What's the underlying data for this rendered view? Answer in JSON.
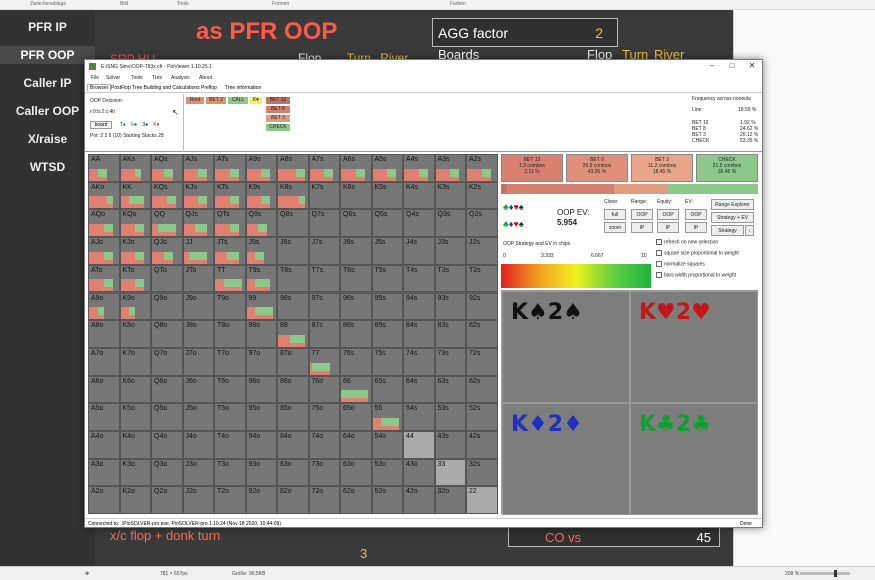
{
  "browser_top": {
    "items": [
      "Zwischenablage",
      "Bild",
      "Tools",
      "Formen",
      "Farben"
    ]
  },
  "left_nav": [
    "PFR IP",
    "PFR OOP",
    "Caller IP",
    "Caller OOP",
    "X/raise",
    "WTSD"
  ],
  "slide": {
    "title": "as PFR OOP",
    "srp": "SRP HU",
    "flop_labels": [
      "Flop",
      "Turn",
      "River"
    ],
    "agg_label": "AGG factor",
    "agg_value": "2",
    "boards_label": "Boards",
    "boards_cols": [
      "Flop",
      "Turn",
      "River"
    ],
    "bottom_text": "x/c flop + donk turn",
    "bottom_num": "3",
    "covs_label": "CO vs",
    "covs_value": "45"
  },
  "window": {
    "title": "E:\\SNG Sims\\OOP-T83x.cfr - PioViewer 1.10.25.1",
    "menu": [
      "File",
      "Solver",
      "Tools",
      "Tree",
      "Analysis",
      "About"
    ],
    "tabs": [
      "Browser",
      "PostFlop Tree Building and Calculations",
      "Preflop",
      "Tree information"
    ],
    "decision_label": "OOP Decision:",
    "line": "r:0:b:2:c:4h",
    "board_btn": "board",
    "board_cards": [
      "T♦",
      "8♣",
      "3♠",
      "K♥"
    ],
    "pot": "Pot: 2 2 6 (10) Starting Stacks 28",
    "path_tags": [
      "Root",
      "BET 2",
      "CALL",
      "K♥"
    ],
    "action_tags": [
      "BET 12",
      "BET 8",
      "BET 3",
      "CHECK"
    ],
    "freq_title": "Frequency across nonouts",
    "freq_line": "Line:",
    "freq_line_val": "18.59 %",
    "freq": [
      {
        "name": "BET 12",
        "val": "1.92 %"
      },
      {
        "name": "BET 8",
        "val": "24.62 %"
      },
      {
        "name": "BET 3",
        "val": "20.12 %"
      },
      {
        "name": "CHECK",
        "val": "53.35 %"
      }
    ],
    "strategy": [
      {
        "name": "BET 12",
        "combos": "1.3 combos",
        "pct": "2.11 %",
        "color": "#d98070"
      },
      {
        "name": "BET 8",
        "combos": "26.9 combos",
        "pct": "43.95 %",
        "color": "#e0907a"
      },
      {
        "name": "BET 3",
        "combos": "11.2 combos",
        "pct": "18.45 %",
        "color": "#e8a58a"
      },
      {
        "name": "CHECK",
        "combos": "21.5 combos",
        "pct": "35.45 %",
        "color": "#8cc88a"
      }
    ],
    "oop_ev_label": "OOP EV:",
    "oop_ev": "5.954",
    "ctl_labels": [
      "Clone:",
      "Range:",
      "Equity:",
      "EV:"
    ],
    "ctl_btns": [
      "full",
      "OOP",
      "OOP",
      "OOP",
      "zoom",
      "IP",
      "IP",
      "IP"
    ],
    "range_explorer": "Range Explorer",
    "strategy_ev": "Strategy + EV",
    "strategy_btn": "Strategy",
    "chips_label": "OOP Strategy and EV in chips",
    "grad_ticks": [
      "0",
      "3.333",
      "6.667",
      "10"
    ],
    "checkboxes": [
      "refresh on new selection",
      "square size proportional to weight",
      "normalize squares",
      "bars width proportional to weight"
    ],
    "combos": [
      {
        "text": "K♠2♠",
        "color": "#111"
      },
      {
        "text": "K♥2♥",
        "color": "#c01818"
      },
      {
        "text": "K♦2♦",
        "color": "#2030c0"
      },
      {
        "text": "K♣2♣",
        "color": "#10a030"
      }
    ],
    "status": "Connected to: .\\PioSOLVER-pro.exe, PioSOLVER-pro 1.10.24 (Nov 18 2020, 10:44:09)",
    "done": "Done"
  },
  "grid": [
    [
      "AA",
      "AKs",
      "AQs",
      "AJs",
      "ATs",
      "A9s",
      "A8s",
      "A7s",
      "A6s",
      "A5s",
      "A4s",
      "A3s",
      "A2s"
    ],
    [
      "AKo",
      "KK",
      "KQs",
      "KJs",
      "KTs",
      "K9s",
      "K8s",
      "K7s",
      "K6s",
      "K5s",
      "K4s",
      "K3s",
      "K2s"
    ],
    [
      "AQo",
      "KQo",
      "QQ",
      "QJs",
      "QTs",
      "Q9s",
      "Q8s",
      "Q7s",
      "Q6s",
      "Q5s",
      "Q4s",
      "Q3s",
      "Q2s"
    ],
    [
      "AJo",
      "KJo",
      "QJo",
      "JJ",
      "JTs",
      "J9s",
      "J8s",
      "J7s",
      "J6s",
      "J5s",
      "J4s",
      "J3s",
      "J2s"
    ],
    [
      "ATo",
      "KTo",
      "QTo",
      "JTo",
      "TT",
      "T9s",
      "T8s",
      "T7s",
      "T6s",
      "T5s",
      "T4s",
      "T3s",
      "T2s"
    ],
    [
      "A9o",
      "K9o",
      "Q9o",
      "J9o",
      "T9o",
      "99",
      "98s",
      "97s",
      "96s",
      "95s",
      "94s",
      "93s",
      "92s"
    ],
    [
      "A8o",
      "K8o",
      "Q8o",
      "J8o",
      "T8o",
      "98o",
      "88",
      "87s",
      "86s",
      "85s",
      "84s",
      "83s",
      "82s"
    ],
    [
      "A7o",
      "K7o",
      "Q7o",
      "J7o",
      "T7o",
      "97o",
      "87o",
      "77",
      "76s",
      "75s",
      "74s",
      "73s",
      "72s"
    ],
    [
      "A6o",
      "K6o",
      "Q6o",
      "J6o",
      "T6o",
      "96o",
      "86o",
      "76o",
      "66",
      "65s",
      "64s",
      "63s",
      "62s"
    ],
    [
      "A5o",
      "K5o",
      "Q5o",
      "J5o",
      "T5o",
      "95o",
      "85o",
      "75o",
      "65o",
      "55",
      "54s",
      "53s",
      "52s"
    ],
    [
      "A4o",
      "K4o",
      "Q4o",
      "J4o",
      "T4o",
      "94o",
      "84o",
      "74o",
      "64o",
      "54o",
      "44",
      "43s",
      "42s"
    ],
    [
      "A3o",
      "K3o",
      "Q3o",
      "J3o",
      "T3o",
      "93o",
      "83o",
      "73o",
      "63o",
      "53o",
      "43o",
      "33",
      "32s"
    ],
    [
      "A2o",
      "K2o",
      "Q2o",
      "J2o",
      "T2o",
      "92o",
      "82o",
      "72o",
      "62o",
      "52o",
      "42o",
      "32o",
      "22"
    ]
  ],
  "window_size": "781 × 657px",
  "file_size": "Größe: 90,5KB",
  "zoom": "208 %"
}
